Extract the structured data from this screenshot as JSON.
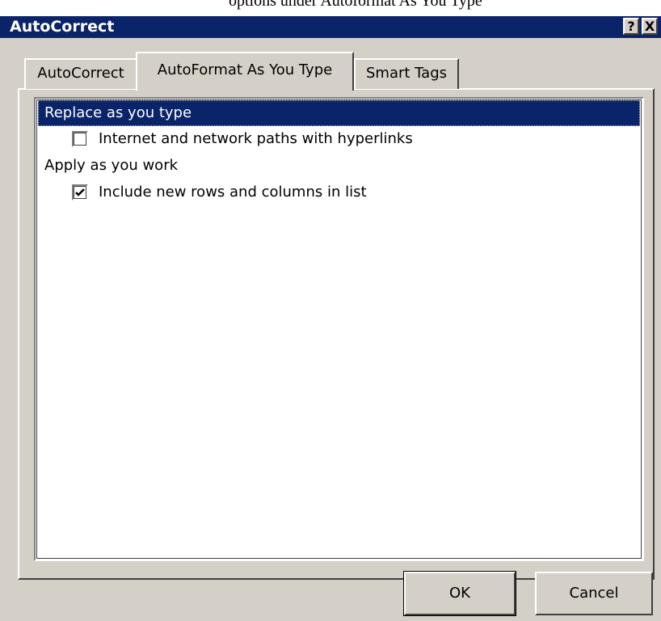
{
  "caption_fragment": "options under Autoformat As You Type",
  "window": {
    "title": "AutoCorrect",
    "help_label": "?",
    "close_label": "X"
  },
  "tabs": [
    {
      "label": "AutoCorrect",
      "active": false
    },
    {
      "label": "AutoFormat As You Type",
      "active": true
    },
    {
      "label": "Smart Tags",
      "active": false
    }
  ],
  "options": {
    "group1": {
      "label": "Replace as you type",
      "selected": true
    },
    "item1": {
      "label": "Internet and network paths with hyperlinks",
      "checked": false
    },
    "group2": {
      "label": "Apply as you work"
    },
    "item2": {
      "label": "Include new rows and columns in list",
      "checked": true
    }
  },
  "buttons": {
    "ok": "OK",
    "cancel": "Cancel"
  },
  "colors": {
    "titlebar": "#0a246a",
    "face": "#d4d0c8",
    "selection": "#0a246a"
  }
}
